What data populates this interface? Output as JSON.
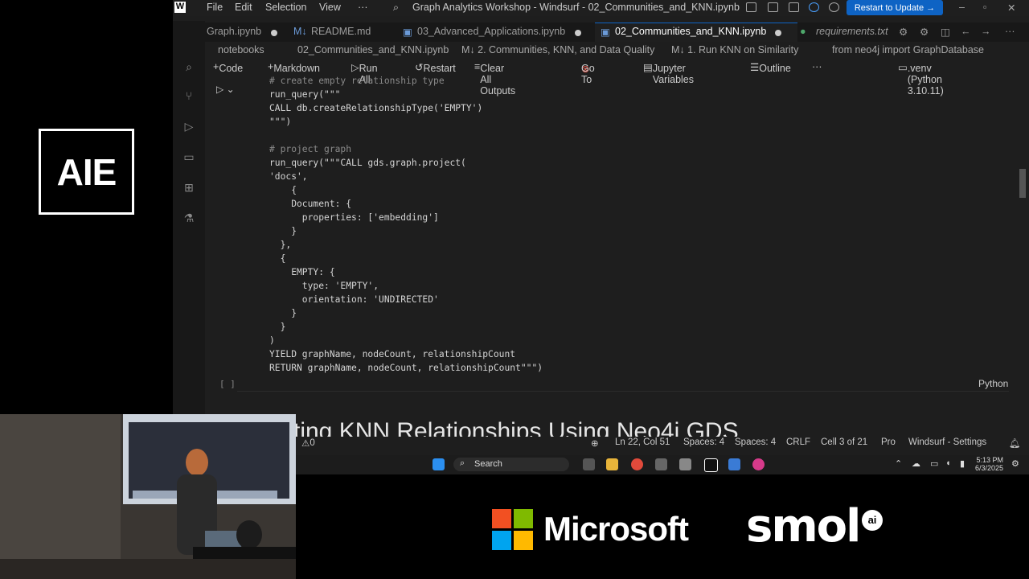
{
  "logo": {
    "text": "AIE"
  },
  "titlebar": {
    "menu": [
      "File",
      "Edit",
      "Selection",
      "View",
      "···"
    ],
    "title": "Graph Analytics Workshop - Windsurf - 02_Communities_and_KNN.ipynb",
    "update_button": "Restart to Update →"
  },
  "tabs": [
    {
      "label": "Graph.ipynb"
    },
    {
      "label": "README.md"
    },
    {
      "label": "03_Advanced_Applications.ipynb"
    },
    {
      "label": "02_Communities_and_KNN.ipynb"
    },
    {
      "label": "requirements.txt"
    }
  ],
  "breadcrumb": [
    "notebooks",
    "02_Communities_and_KNN.ipynb",
    "M↓ 2. Communities, KNN, and Data Quality",
    "M↓ 1. Run KNN on Similarity",
    "from neo4j import GraphDatabase"
  ],
  "toolbar": {
    "code": "Code",
    "markdown": "Markdown",
    "run_all": "Run All",
    "restart": "Restart",
    "clear_outputs": "Clear All Outputs",
    "go_to": "Go To",
    "jupyter_variables": "Jupyter Variables",
    "outline": "Outline",
    "more": "···",
    "kernel": ".venv (Python 3.10.11)"
  },
  "code_lines": [
    "# create empty relationship type",
    "run_query(\"\"\"",
    "CALL db.createRelationshipType('EMPTY')",
    "\"\"\")",
    "",
    "# project graph",
    "run_query(\"\"\"CALL gds.graph.project(",
    "'docs',",
    "    {",
    "    Document: {",
    "      properties: ['embedding']",
    "    }",
    "  },",
    "  {",
    "    EMPTY: {",
    "      type: 'EMPTY',",
    "      orientation: 'UNDIRECTED'",
    "    }",
    "  }",
    ")",
    "YIELD graphName, nodeCount, relationshipCount",
    "RETURN graphName, nodeCount, relationshipCount\"\"\")"
  ],
  "cell": {
    "exec_count": "[ ]",
    "language": "Python"
  },
  "markdown_heading": "ting KNN Relationships Using Neo4j GDS",
  "statusbar": {
    "problems": "0",
    "position": "Ln 22, Col 51",
    "spaces1": "Spaces: 4",
    "spaces2": "Spaces: 4",
    "eol": "CRLF",
    "cell": "Cell 3 of 21",
    "plan": "Pro",
    "settings": "Windsurf - Settings"
  },
  "taskbar": {
    "search": "Search",
    "time": "5:13 PM",
    "date": "6/3/2025"
  },
  "sponsors": {
    "microsoft": "Microsoft",
    "smol": "smol",
    "smol_ai": "ai"
  },
  "colors": {
    "accent": "#0e63c4",
    "editor_bg": "#1e1e1e"
  }
}
